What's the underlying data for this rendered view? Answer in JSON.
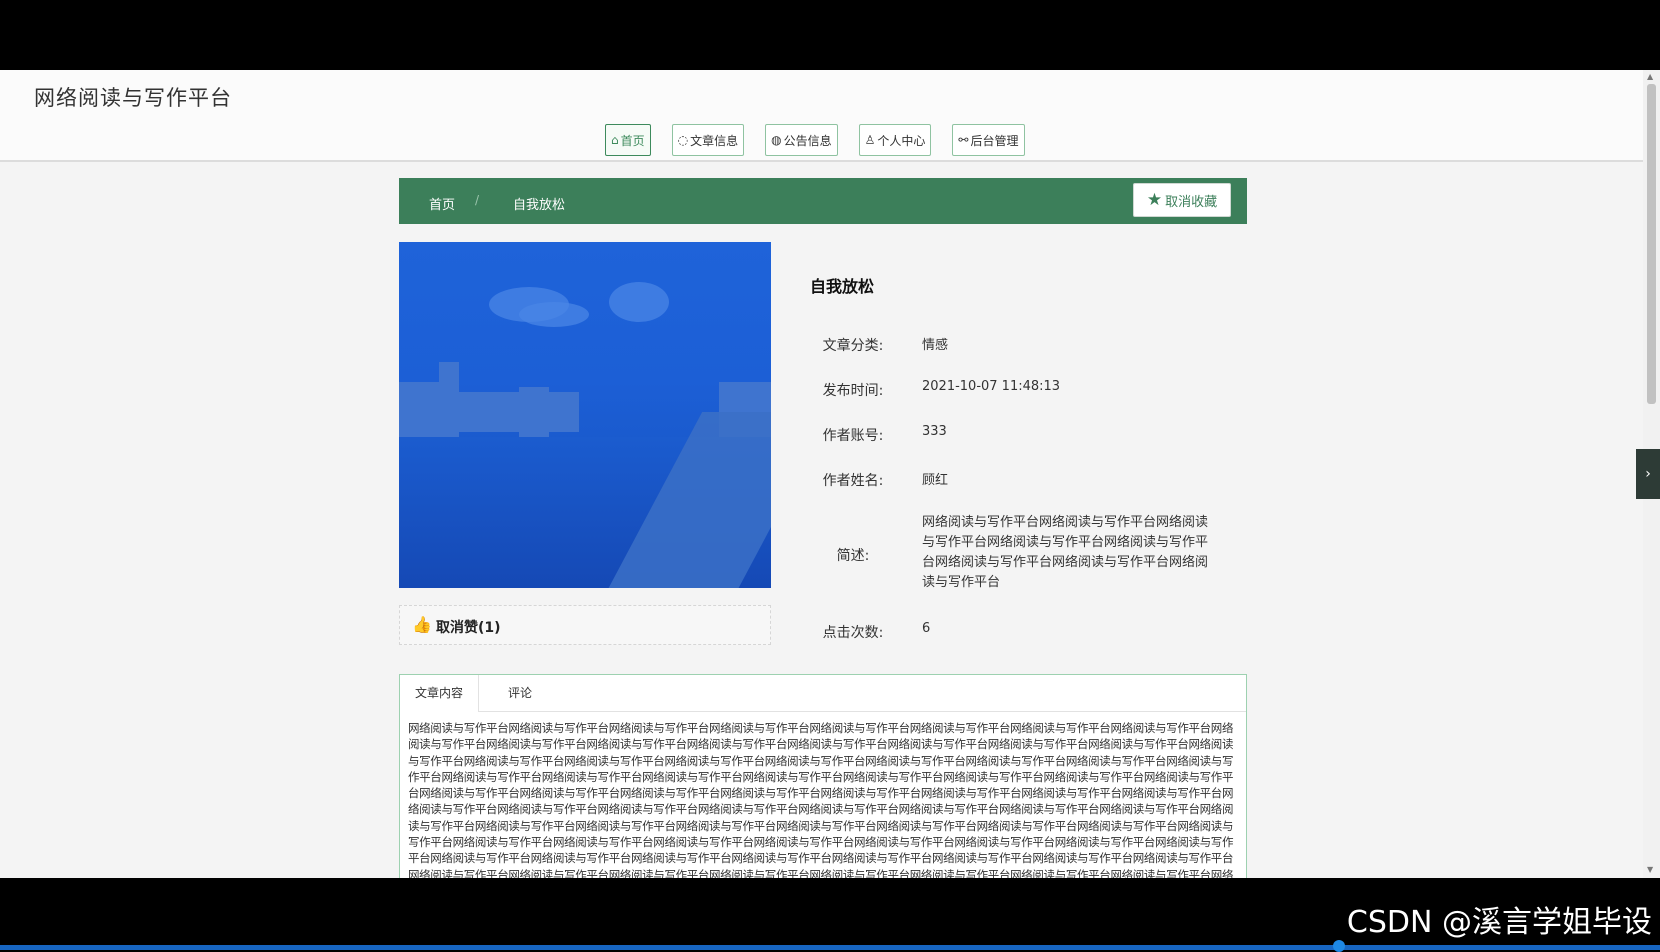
{
  "site": {
    "title": "网络阅读与写作平台"
  },
  "nav": [
    {
      "label": "首页",
      "icon": "home-icon",
      "glyph": "⌂"
    },
    {
      "label": "文章信息",
      "icon": "palette-icon",
      "glyph": "◌"
    },
    {
      "label": "公告信息",
      "icon": "globe-icon",
      "glyph": "◍"
    },
    {
      "label": "个人中心",
      "icon": "user-icon",
      "glyph": "♙"
    },
    {
      "label": "后台管理",
      "icon": "link-icon",
      "glyph": "⚯"
    }
  ],
  "breadcrumb": {
    "home": "首页",
    "separator": "/",
    "current": "自我放松"
  },
  "favorite": {
    "label": "取消收藏",
    "icon": "star-icon"
  },
  "like": {
    "label": "取消赞(1)",
    "icon": "thumbs-up-icon"
  },
  "article": {
    "title": "自我放松",
    "fields": [
      {
        "label": "文章分类:",
        "value": "情感"
      },
      {
        "label": "发布时间:",
        "value": "2021-10-07 11:48:13"
      },
      {
        "label": "作者账号:",
        "value": "333"
      },
      {
        "label": "作者姓名:",
        "value": "顾红"
      }
    ],
    "summary_label": "简述:",
    "summary": "网络阅读与写作平台网络阅读与写作平台网络阅读与写作平台网络阅读与写作平台网络阅读与写作平台网络阅读与写作平台网络阅读与写作平台网络阅读与写作平台",
    "clicks_label": "点击次数:",
    "clicks": "6"
  },
  "tabs": [
    {
      "label": "文章内容"
    },
    {
      "label": "评论"
    }
  ],
  "content": "网络阅读与写作平台网络阅读与写作平台网络阅读与写作平台网络阅读与写作平台网络阅读与写作平台网络阅读与写作平台网络阅读与写作平台网络阅读与写作平台网络阅读与写作平台网络阅读与写作平台网络阅读与写作平台网络阅读与写作平台网络阅读与写作平台网络阅读与写作平台网络阅读与写作平台网络阅读与写作平台网络阅读与写作平台网络阅读与写作平台网络阅读与写作平台网络阅读与写作平台网络阅读与写作平台网络阅读与写作平台网络阅读与写作平台网络阅读与写作平台网络阅读与写作平台网络阅读与写作平台网络阅读与写作平台网络阅读与写作平台网络阅读与写作平台网络阅读与写作平台网络阅读与写作平台网络阅读与写作平台网络阅读与写作平台网络阅读与写作平台网络阅读与写作平台网络阅读与写作平台网络阅读与写作平台网络阅读与写作平台网络阅读与写作平台网络阅读与写作平台网络阅读与写作平台网络阅读与写作平台网络阅读与写作平台网络阅读与写作平台网络阅读与写作平台网络阅读与写作平台网络阅读与写作平台网络阅读与写作平台网络阅读与写作平台网络阅读与写作平台网络阅读与写作平台网络阅读与写作平台网络阅读与写作平台网络阅读与写作平台网络阅读与写作平台网络阅读与写作平台网络阅读与写作平台网络阅读与写作平台网络阅读与写作平台网络阅读与写作平台网络阅读与写作平台网络阅读与写作平台网络阅读与写作平台网络阅读与写作平台网络阅读与写作平台网络阅读与写作平台网络阅读与写作平台网络阅读与写作平台网络阅读与写作平台网络阅读与写作平台网络阅读与写作平台网络阅读与写作平台网络阅读与写作平台网络阅读与写作平台网络阅读与写作平台网络阅读与写作平台网络阅读与写作平台网络阅读与写作平台网络阅读与写作平台网络阅读与写作平台网络阅读与写作平台网络阅读与写作平台网络阅读与写作平台网络阅读与写作平台网络阅读与写作平台网络阅读与写作平台网络阅读与写作平台网络阅读与写作平台网络阅读与写作平台网络阅读与写作平台网络阅读与写作平台",
  "watermark": "CSDN @溪言学姐毕设",
  "colors": {
    "primary": "#3c7f5a",
    "accent_border": "#9dd1b0",
    "like": "#e8462f"
  }
}
